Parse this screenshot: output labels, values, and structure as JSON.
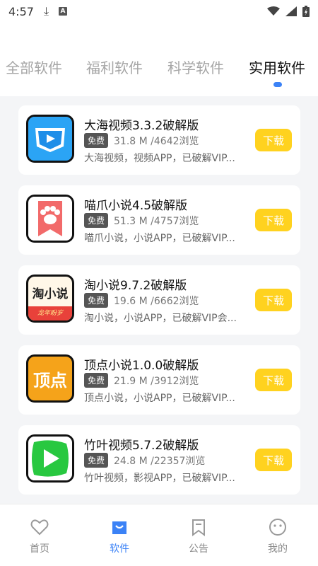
{
  "status_bar": {
    "time": "4:57"
  },
  "tabs": [
    {
      "label": "全部软件",
      "active": false
    },
    {
      "label": "福利软件",
      "active": false
    },
    {
      "label": "科学软件",
      "active": false
    },
    {
      "label": "实用软件",
      "active": true
    }
  ],
  "apps": [
    {
      "title": "大海视频3.3.2破解版",
      "badge": "免费",
      "meta": "31.8 M /4642浏览",
      "desc": "大海视频，视频APP，已破解VIP...",
      "download": "下载",
      "icon": "video-play-icon"
    },
    {
      "title": "喵爪小说4.5破解版",
      "badge": "免费",
      "meta": "51.3 M /4757浏览",
      "desc": "喵爪小说，小说APP，已破解VIP...",
      "download": "下载",
      "icon": "paw-icon"
    },
    {
      "title": "淘小说9.7.2破解版",
      "badge": "免费",
      "meta": "19.6 M /6662浏览",
      "desc": "淘小说，小说APP，已破解VIP会...",
      "download": "下载",
      "icon": "tao-novel-icon",
      "icon_text": "淘小说",
      "icon_sub": "龙年盼岁"
    },
    {
      "title": "顶点小说1.0.0破解版",
      "badge": "免费",
      "meta": "21.9 M /3912浏览",
      "desc": "顶点小说，小说APP，已破解VIP...",
      "download": "下载",
      "icon": "dingdian-icon",
      "icon_text": "顶点"
    },
    {
      "title": "竹叶视频5.7.2破解版",
      "badge": "免费",
      "meta": "24.8 M /22357浏览",
      "desc": "竹叶视频，影视APP，已破解VIP...",
      "download": "下载",
      "icon": "leaf-play-icon"
    }
  ],
  "bottom_nav": [
    {
      "label": "首页",
      "icon": "heart-icon",
      "active": false
    },
    {
      "label": "软件",
      "icon": "bag-icon",
      "active": true
    },
    {
      "label": "公告",
      "icon": "bookmark-icon",
      "active": false
    },
    {
      "label": "我的",
      "icon": "smile-icon",
      "active": false
    }
  ],
  "colors": {
    "accent": "#3b82f6",
    "download": "#ffd21f"
  }
}
